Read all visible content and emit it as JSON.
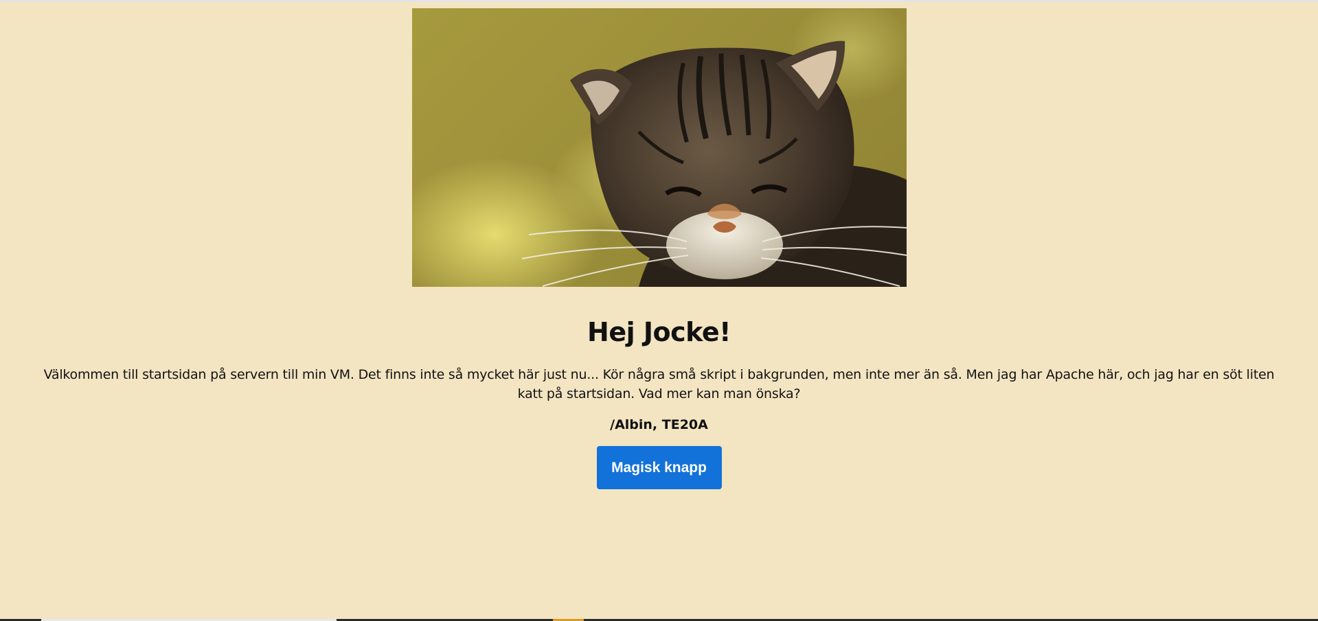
{
  "page": {
    "title": "Hej Jocke!",
    "intro": "Välkommen till startsidan på servern till min VM. Det finns inte så mycket här just nu... Kör några små skript i bakgrunden, men inte mer än så. Men jag har Apache här, och jag har en söt liten katt på startsidan. Vad mer kan man önska?",
    "signature": "/Albin, TE20A",
    "button_label": "Magisk knapp"
  },
  "image": {
    "icon": "cat-photo"
  },
  "colors": {
    "background": "#f3e4c2",
    "button": "#1272d9",
    "button_text": "#ffffff",
    "text": "#111111"
  }
}
